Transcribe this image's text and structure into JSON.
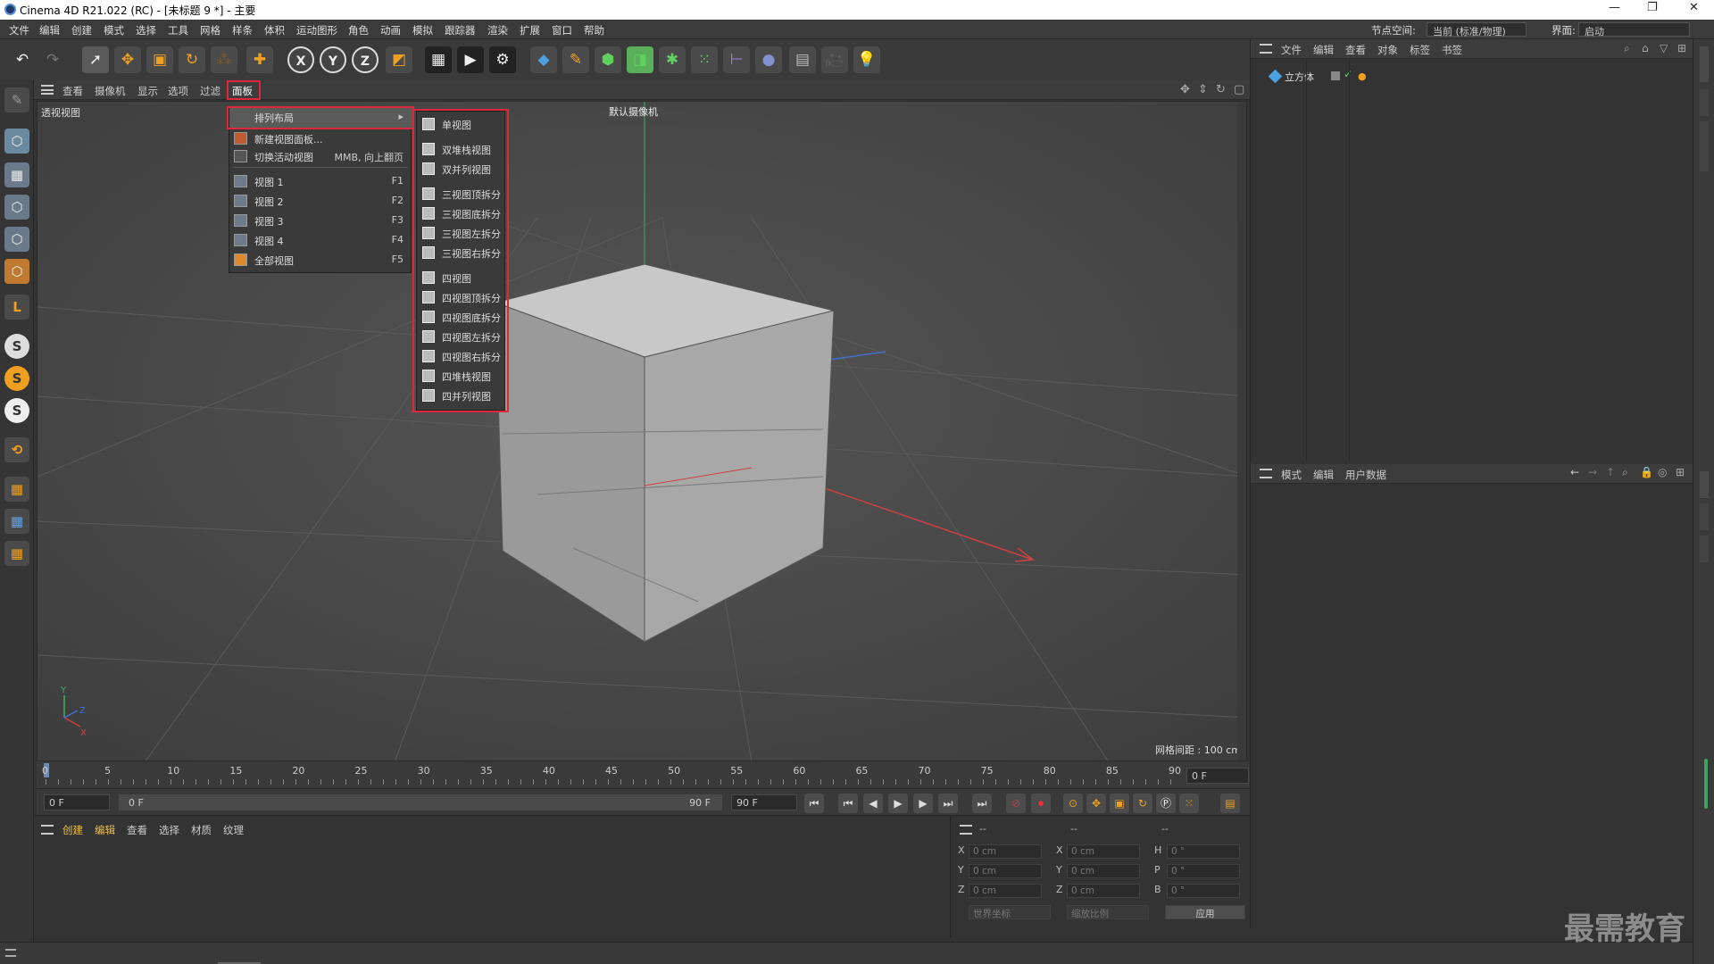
{
  "titlebar": {
    "title": "Cinema 4D R21.022 (RC) - [未标题 9 *] - 主要"
  },
  "menubar": {
    "items": [
      "文件",
      "编辑",
      "创建",
      "模式",
      "选择",
      "工具",
      "网格",
      "样条",
      "体积",
      "运动图形",
      "角色",
      "动画",
      "模拟",
      "跟踪器",
      "渲染",
      "扩展",
      "窗口",
      "帮助"
    ],
    "node_space_label": "节点空间:",
    "node_space_value": "当前 (标准/物理)",
    "interface_label": "界面:",
    "interface_value": "启动"
  },
  "viewport_menu": {
    "items": [
      "查看",
      "摄像机",
      "显示",
      "选项",
      "过滤",
      "面板"
    ]
  },
  "viewport": {
    "name": "透视视图",
    "camera": "默认摄像机",
    "grid_info": "网格间距 : 100 cm"
  },
  "panel_menu": {
    "items": [
      {
        "label": "排列布局",
        "shortcut": ""
      },
      {
        "label": "新建视图面板...",
        "shortcut": ""
      },
      {
        "label": "切换活动视图",
        "shortcut": "MMB, 向上翻页"
      },
      {
        "label": "视图 1",
        "shortcut": "F1"
      },
      {
        "label": "视图 2",
        "shortcut": "F2"
      },
      {
        "label": "视图 3",
        "shortcut": "F3"
      },
      {
        "label": "视图 4",
        "shortcut": "F4"
      },
      {
        "label": "全部视图",
        "shortcut": "F5"
      }
    ]
  },
  "layout_submenu": {
    "items": [
      "单视图",
      "双堆栈视图",
      "双并列视图",
      "三视图顶拆分",
      "三视图底拆分",
      "三视图左拆分",
      "三视图右拆分",
      "四视图",
      "四视图顶拆分",
      "四视图底拆分",
      "四视图左拆分",
      "四视图右拆分",
      "四堆栈视图",
      "四并列视图"
    ]
  },
  "object_manager": {
    "menu": [
      "文件",
      "编辑",
      "查看",
      "对象",
      "标签",
      "书签"
    ],
    "objects": [
      {
        "name": "立方体"
      }
    ]
  },
  "attribute_manager": {
    "menu": [
      "模式",
      "编辑",
      "用户数据"
    ]
  },
  "timeline": {
    "ticks": [
      "0",
      "5",
      "10",
      "15",
      "20",
      "25",
      "30",
      "35",
      "40",
      "45",
      "50",
      "55",
      "60",
      "65",
      "70",
      "75",
      "80",
      "85",
      "90"
    ],
    "current_frame_display": "0 F"
  },
  "transport": {
    "start_frame": "0 F",
    "range_start": "0 F",
    "range_end": "90 F",
    "end_frame": "90 F"
  },
  "material_manager": {
    "menu": [
      "创建",
      "编辑",
      "查看",
      "选择",
      "材质",
      "纹理"
    ]
  },
  "coordinates": {
    "col_headers": [
      "--",
      "--",
      "--"
    ],
    "rows": [
      {
        "axis": "X",
        "pos": "0 cm",
        "axis2": "X",
        "size": "0 cm",
        "axis3": "H",
        "rot": "0 °"
      },
      {
        "axis": "Y",
        "pos": "0 cm",
        "axis2": "Y",
        "size": "0 cm",
        "axis3": "P",
        "rot": "0 °"
      },
      {
        "axis": "Z",
        "pos": "0 cm",
        "axis2": "Z",
        "size": "0 cm",
        "axis3": "B",
        "rot": "0 °"
      }
    ],
    "space_value": "世界坐标",
    "scale_value": "缩放比例",
    "apply_label": "应用"
  },
  "watermark": "最需教育",
  "colors": {
    "highlight_red": "#e0263a",
    "accent_orange": "#f0a020",
    "x_axis": "#d04040",
    "y_axis": "#40b060",
    "z_axis": "#4070d0"
  }
}
